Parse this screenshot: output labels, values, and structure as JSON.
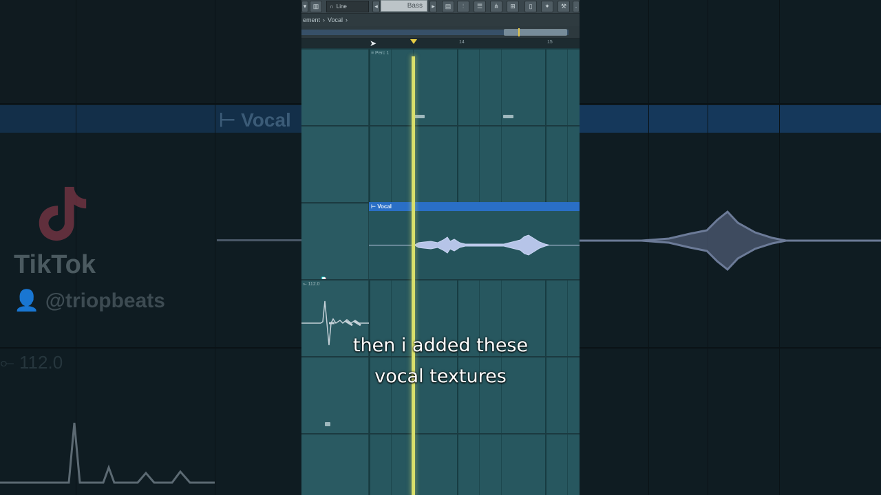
{
  "toolbar": {
    "mode_label": "Line",
    "preset": "Bass"
  },
  "breadcrumb": {
    "parent": "ement",
    "separator": "›",
    "current": "Vocal"
  },
  "ruler": {
    "marks": [
      "14",
      "15"
    ]
  },
  "tracks": {
    "perc_pattern": "Perc 1",
    "vocal_clip": "Vocal",
    "tempo_label": "112.0"
  },
  "background": {
    "vocal_label": "Vocal",
    "tempo_label": "112.0"
  },
  "watermark": {
    "brand": "TikTok",
    "handle": "@triopbeats"
  },
  "captions": {
    "line1": "then i added these",
    "line2": "vocal textures"
  },
  "colors": {
    "playhead": "#d8df6b",
    "clip_header": "#2a6fc6",
    "track_bg": "#27575f",
    "caption_text": "#ffffff"
  }
}
